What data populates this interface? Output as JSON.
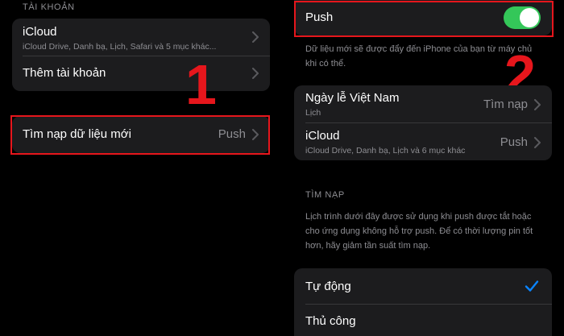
{
  "left": {
    "section_header": "TÀI KHOẢN",
    "accounts": [
      {
        "title": "iCloud",
        "subtitle": "iCloud Drive, Danh bạ, Lịch, Safari và 5 mục khác..."
      },
      {
        "title": "Thêm tài khoản"
      }
    ],
    "fetch_row": {
      "title": "Tìm nạp dữ liệu mới",
      "value": "Push"
    },
    "annotation_number": "1"
  },
  "right": {
    "push_row": {
      "title": "Push",
      "toggle_on": true
    },
    "push_description": "Dữ liệu mới sẽ được đẩy đến iPhone của bạn từ máy chủ khi có thể.",
    "annotation_number": "2",
    "accounts": [
      {
        "title": "Ngày lễ Việt Nam",
        "subtitle": "Lịch",
        "value": "Tìm nạp"
      },
      {
        "title": "iCloud",
        "subtitle": "iCloud Drive, Danh bạ, Lịch và 6 mục khác",
        "value": "Push"
      }
    ],
    "fetch_header": "TÌM NẠP",
    "fetch_description": "Lịch trình dưới đây được sử dụng khi push được tắt hoặc cho ứng dụng không hỗ trợ push. Để có thời lượng pin tốt hơn, hãy giảm tần suất tìm nạp.",
    "schedule_options": [
      {
        "label": "Tự động",
        "selected": true
      },
      {
        "label": "Thủ công",
        "selected": false
      }
    ]
  },
  "colors": {
    "accent_blue": "#0a84ff",
    "toggle_green": "#34c759",
    "highlight_red": "#e6161c",
    "cell_background": "#1c1c1e"
  },
  "icons": [
    "chevron-right-icon",
    "checkmark-icon"
  ]
}
